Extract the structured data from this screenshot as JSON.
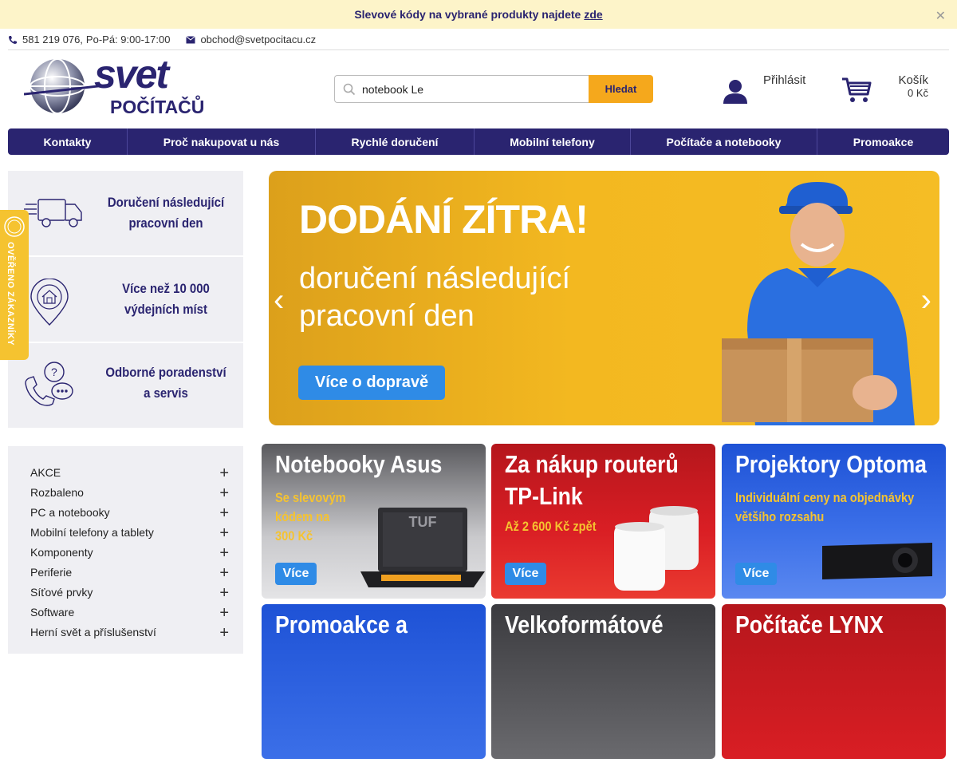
{
  "notice": {
    "text": "Slevové kódy na vybrané produkty najdete",
    "link": "zde",
    "close": "✕"
  },
  "contact": {
    "phone": "581 219 076",
    "sep": ",",
    "hours": "Po-Pá: 9:00-17:00",
    "email": "obchod@svetpocitacu.cz"
  },
  "logo": {
    "line1": "svet",
    "line2": "POČÍTAČŮ"
  },
  "search": {
    "value": "notebook Le",
    "button": "Hledat"
  },
  "account": {
    "login": "Přihlásit"
  },
  "cart": {
    "label": "Košík",
    "price": "0 Kč"
  },
  "nav": [
    {
      "label": "Kontakty"
    },
    {
      "label": "Proč nakupovat u nás"
    },
    {
      "label": "Rychlé doručení"
    },
    {
      "label": "Mobilní telefony"
    },
    {
      "label": "Počítače a notebooky"
    },
    {
      "label": "Promoakce"
    }
  ],
  "features": [
    {
      "line1": "Doručení následující",
      "line2": "pracovní den",
      "icon": "truck-icon"
    },
    {
      "line1": "Více než 10 000",
      "line2": "výdejních míst",
      "icon": "location-house-icon"
    },
    {
      "line1": "Odborné poradenství",
      "line2": "a servis",
      "icon": "support-phone-icon"
    }
  ],
  "badge": {
    "text": "OVĚŘENO ZÁKAZNÍKY"
  },
  "hero": {
    "title": "DODÁNÍ ZÍTRA!",
    "line1": "doručení následující",
    "line2": "pracovní den",
    "cta": "Více o dopravě",
    "prev": "‹",
    "next": "›"
  },
  "categories": [
    {
      "label": " AKCE",
      "plus": "+"
    },
    {
      "label": " Rozbaleno",
      "plus": "+"
    },
    {
      "label": "PC a notebooky",
      "plus": "+"
    },
    {
      "label": "Mobilní telefony a tablety",
      "plus": "+"
    },
    {
      "label": "Komponenty",
      "plus": "+"
    },
    {
      "label": "Periferie",
      "plus": "+"
    },
    {
      "label": "Síťové prvky",
      "plus": "+"
    },
    {
      "label": "Software",
      "plus": "+"
    },
    {
      "label": "Herní svět a příslušenství",
      "plus": "+"
    }
  ],
  "tiles": [
    {
      "title": "Notebooky Asus",
      "sub1": "Se slevovým",
      "sub2": "kódem na",
      "sub3": "300 Kč",
      "more": "Více",
      "brand": "TUF"
    },
    {
      "title": "Za nákup routerů",
      "title2": "TP-Link",
      "sub1": "Až 2 600 Kč zpět",
      "more": "Více"
    },
    {
      "title": "Projektory Optoma",
      "sub1": "Individuální ceny na objednávky",
      "sub2": "většího rozsahu",
      "more": "Více"
    },
    {
      "title": "Promoakce a"
    },
    {
      "title": "Velkoformátové"
    },
    {
      "title": "Počítače LYNX"
    }
  ],
  "colors": {
    "brand": "#2a2470",
    "accent": "#f5a81c",
    "cta": "#2f8be6",
    "notice_bg": "#fdf4c9"
  }
}
